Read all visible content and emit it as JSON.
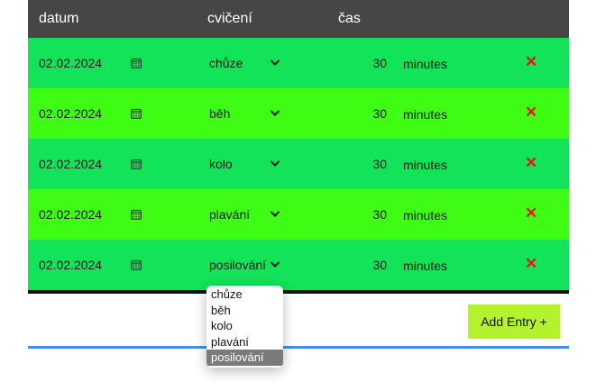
{
  "header": {
    "date_label": "datum",
    "exercise_label": "cvičení",
    "time_label": "čas"
  },
  "rows": [
    {
      "date": "02.02.2024",
      "exercise": "chůze",
      "time": "30",
      "unit": "minutes",
      "delete": "✕",
      "bg": "#12e358"
    },
    {
      "date": "02.02.2024",
      "exercise": "běh",
      "time": "30",
      "unit": "minutes",
      "delete": "✕",
      "bg": "#3ffc15"
    },
    {
      "date": "02.02.2024",
      "exercise": "kolo",
      "time": "30",
      "unit": "minutes",
      "delete": "✕",
      "bg": "#12e358"
    },
    {
      "date": "02.02.2024",
      "exercise": "plavání",
      "time": "30",
      "unit": "minutes",
      "delete": "✕",
      "bg": "#3ffc15"
    },
    {
      "date": "02.02.2024",
      "exercise": "posilování",
      "time": "30",
      "unit": "minutes",
      "delete": "✕",
      "bg": "#12e358"
    }
  ],
  "add_button": {
    "label": "Add Entry +"
  },
  "dropdown": {
    "options": [
      "chůze",
      "běh",
      "kolo",
      "plavání",
      "posilování"
    ],
    "selected": "posilování"
  },
  "colors": {
    "header_bg": "#464646",
    "row_green": "#12e358",
    "row_lime": "#3ffc15",
    "delete_red": "#ee1111",
    "add_button_bg": "#b5f22e",
    "accent_line": "#3f8ee8"
  },
  "icons": {
    "calendar": "calendar-icon",
    "chevron": "chevron-down-icon",
    "delete": "close-icon"
  }
}
